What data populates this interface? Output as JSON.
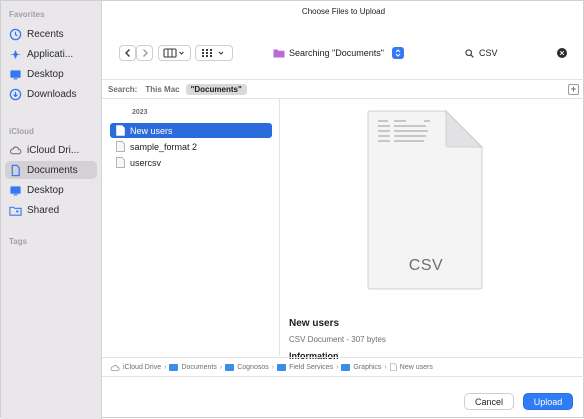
{
  "dialog": {
    "title": "Choose Files to Upload"
  },
  "sidebar": {
    "favorites_label": "Favorites",
    "icloud_label": "iCloud",
    "tags_label": "Tags",
    "favorites": [
      {
        "label": "Recents",
        "icon": "clock-icon"
      },
      {
        "label": "Applicati...",
        "icon": "applications-icon"
      },
      {
        "label": "Desktop",
        "icon": "desktop-icon"
      },
      {
        "label": "Downloads",
        "icon": "download-icon"
      }
    ],
    "icloud": [
      {
        "label": "iCloud Dri...",
        "icon": "cloud-icon"
      },
      {
        "label": "Documents",
        "icon": "document-icon",
        "selected": true
      },
      {
        "label": "Desktop",
        "icon": "desktop-icon"
      },
      {
        "label": "Shared",
        "icon": "shared-folder-icon"
      }
    ]
  },
  "toolbar": {
    "search_location": "Searching \"Documents\"",
    "search_query": "CSV"
  },
  "scope": {
    "label": "Search:",
    "options": [
      "This Mac",
      "\"Documents\""
    ],
    "selected": "\"Documents\""
  },
  "file_list": {
    "group": "2023",
    "items": [
      {
        "name": "New users",
        "selected": true
      },
      {
        "name": "sample_format 2",
        "selected": false
      },
      {
        "name": "usercsv",
        "selected": false
      }
    ]
  },
  "preview": {
    "badge": "CSV",
    "name": "New users",
    "kind": "CSV Document - 307 bytes",
    "info_heading": "Information"
  },
  "pathbar": {
    "crumbs": [
      "iCloud Drive",
      "Documents",
      "Cognosos",
      "Field Services",
      "Graphics",
      "New users"
    ]
  },
  "buttons": {
    "cancel": "Cancel",
    "upload": "Upload"
  },
  "colors": {
    "accent": "#2f7cf6",
    "selection": "#2c6bdb",
    "sidebar_bg": "#e9e7ea"
  }
}
